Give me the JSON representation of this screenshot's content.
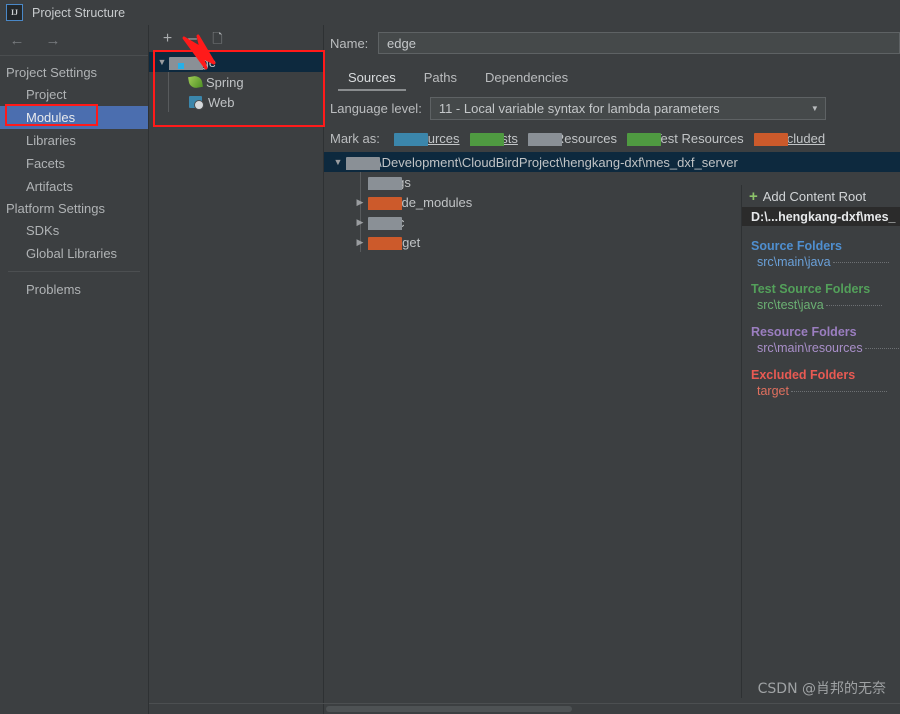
{
  "window": {
    "title": "Project Structure",
    "logo_text": "IJ"
  },
  "nav": {
    "back_icon": "arrow-left-icon",
    "forward_icon": "arrow-right-icon"
  },
  "sidebar": {
    "groups": [
      {
        "label": "Project Settings",
        "items": [
          {
            "label": "Project",
            "selected": false
          },
          {
            "label": "Modules",
            "selected": true
          },
          {
            "label": "Libraries",
            "selected": false
          },
          {
            "label": "Facets",
            "selected": false
          },
          {
            "label": "Artifacts",
            "selected": false
          }
        ]
      },
      {
        "label": "Platform Settings",
        "items": [
          {
            "label": "SDKs",
            "selected": false
          },
          {
            "label": "Global Libraries",
            "selected": false
          }
        ]
      }
    ],
    "problems": "Problems"
  },
  "module_panel": {
    "toolbar": {
      "add": "+",
      "remove": "–",
      "copy": "copy-icon"
    },
    "tree": [
      {
        "label": "edge",
        "icon": "module-folder-icon",
        "selected": true,
        "expanded": true
      },
      {
        "label": "Spring",
        "icon": "spring-leaf-icon",
        "selected": false
      },
      {
        "label": "Web",
        "icon": "web-icon",
        "selected": false
      }
    ]
  },
  "main": {
    "name_label": "Name:",
    "name_value": "edge",
    "tabs": [
      {
        "label": "Sources",
        "active": true
      },
      {
        "label": "Paths",
        "active": false
      },
      {
        "label": "Dependencies",
        "active": false
      }
    ],
    "language_level_label": "Language level:",
    "language_level_value": "11 - Local variable syntax for lambda parameters",
    "mark_as_label": "Mark as:",
    "mark_as_items": [
      {
        "label": "Sources",
        "color": "#3b86ab"
      },
      {
        "label": "Tests",
        "color": "#4f9a41"
      },
      {
        "label": "Resources",
        "color": "#8a9096"
      },
      {
        "label": "Test Resources",
        "color": "#4f9a41"
      },
      {
        "label": "Excluded",
        "color": "#cc5a2b"
      }
    ],
    "content_tree": [
      {
        "label": "D:\\Development\\CloudBirdProject\\hengkang-dxf\\mes_dxf_server",
        "icon": "folder-gray-icon",
        "selected": true,
        "expandable": true
      },
      {
        "label": "logs",
        "icon": "folder-gray-icon",
        "selected": false,
        "expandable": false
      },
      {
        "label": "node_modules",
        "icon": "folder-orange-icon",
        "selected": false,
        "expandable": true
      },
      {
        "label": "src",
        "icon": "folder-gray-icon",
        "selected": false,
        "expandable": true
      },
      {
        "label": "target",
        "icon": "folder-orange-icon",
        "selected": false,
        "expandable": true
      }
    ]
  },
  "roots_panel": {
    "add_content_root": "Add Content Root",
    "content_root": "D:\\...hengkang-dxf\\mes_",
    "groups": [
      {
        "title": "Source Folders",
        "title_color": "#4f8fd0",
        "path": "src\\main\\java",
        "path_color": "#6aa0d8"
      },
      {
        "title": "Test Source Folders",
        "title_color": "#53a05a",
        "path": "src\\test\\java",
        "path_color": "#6bb073"
      },
      {
        "title": "Resource Folders",
        "title_color": "#9b7ec0",
        "path": "src\\main\\resources",
        "path_color": "#a98fc9"
      },
      {
        "title": "Excluded Folders",
        "title_color": "#e85a53",
        "path": "target",
        "path_color": "#e0705f"
      }
    ]
  },
  "watermark": "CSDN @肖邦的无奈",
  "colors": {
    "background": "#3c3f41",
    "selection_blue": "#4b6eaf",
    "tree_selection": "#0d293e",
    "annotation_red": "#ff1a1a"
  }
}
